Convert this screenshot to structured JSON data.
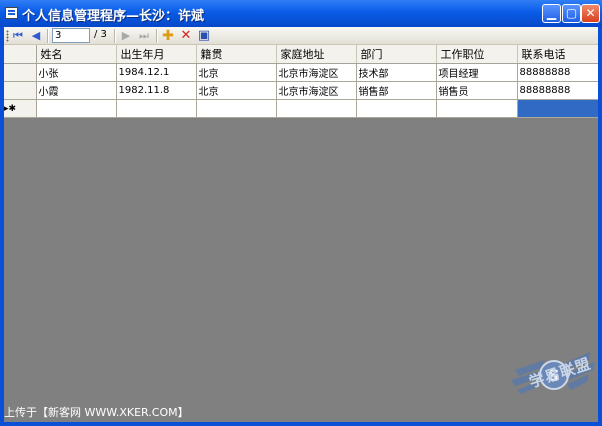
{
  "window": {
    "title": "个人信息管理程序—长沙：许斌"
  },
  "navigator": {
    "position_value": "3",
    "count_text": "/ 3"
  },
  "grid": {
    "columns": [
      "姓名",
      "出生年月",
      "籍贯",
      "家庭地址",
      "部门",
      "工作职位",
      "联系电话"
    ],
    "rows": [
      [
        "小张",
        "1984.12.1",
        "北京",
        "北京市海淀区",
        "技术部",
        "项目经理",
        "88888888"
      ],
      [
        "小霞",
        "1982.11.8",
        "北京",
        "北京市海淀区",
        "销售部",
        "销售员",
        "88888888"
      ]
    ],
    "new_row_marker": "▸✱"
  },
  "watermark": {
    "text": "上传于【新客网 WWW.XKER.COM】"
  },
  "logo": {
    "text": "学易联盟"
  },
  "colors": {
    "titlebar": "#0a5ce8",
    "client_bg": "#808080",
    "selection": "#316ac5"
  }
}
